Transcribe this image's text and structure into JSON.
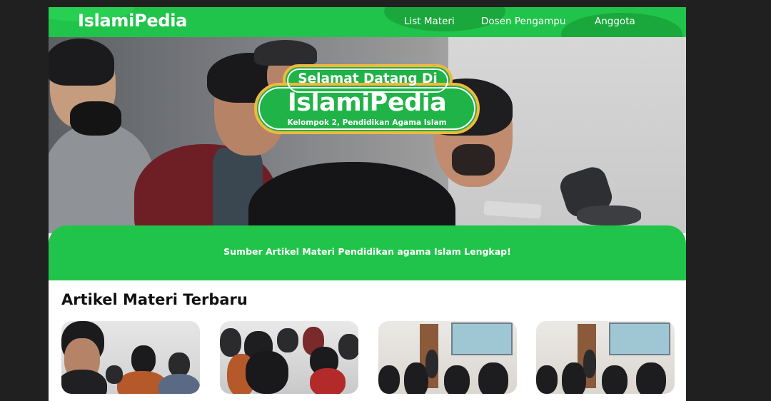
{
  "nav": {
    "brand": "IslamiPedia",
    "links": [
      "List Materi",
      "Dosen Pengampu",
      "Anggota"
    ]
  },
  "hero": {
    "welcome_line1": "Selamat Datang Di",
    "welcome_title": "IslamiPedia",
    "welcome_sub": "Kelompok 2, Pendidikan Agama Islam",
    "tagline": "Sumber Artikel Materi Pendidikan agama Islam Lengkap!"
  },
  "articles": {
    "section_title": "Artikel Materi Terbaru"
  },
  "colors": {
    "brand_green": "#21c44a",
    "badge_border": "#f2b83b",
    "background": "#202020"
  }
}
